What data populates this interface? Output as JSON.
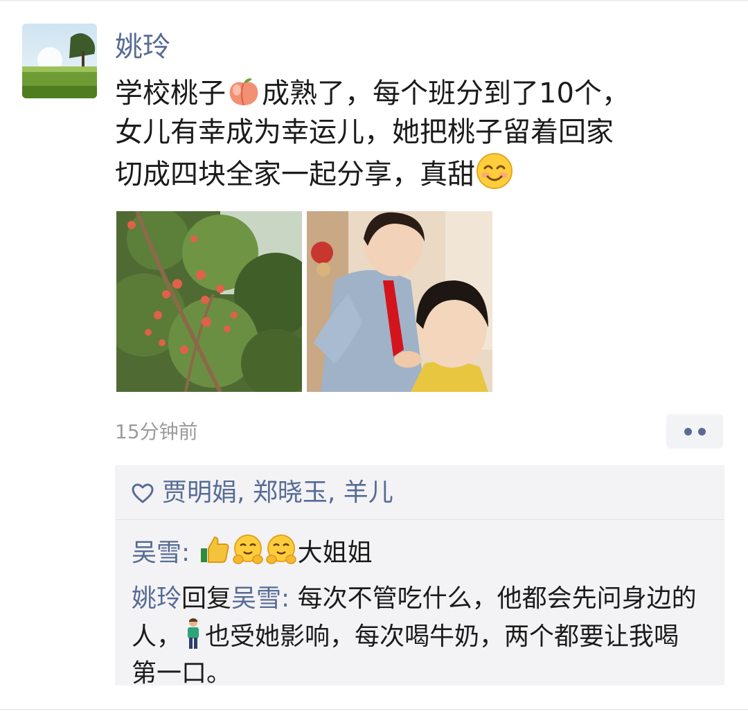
{
  "post": {
    "author": "姚玲",
    "text_part1": "学校桃子",
    "peach_emoji": "peach-emoji",
    "text_part2": "成熟了，每个班分到了10个，\n女儿有幸成为幸运儿，她把桃子留着回家\n切成四块全家一起分享，真甜",
    "smile_emoji": "smiling-face-emoji",
    "timestamp": "15分钟前"
  },
  "likes": {
    "names": "贾明娟, 郑晓玉, 羊儿"
  },
  "comments": [
    {
      "author": "吴雪",
      "separator": ": ",
      "emojis": [
        "thumbs-up-emoji",
        "hugging-face-emoji",
        "hugging-face-emoji"
      ],
      "text": "大姐姐"
    },
    {
      "author": "姚玲",
      "reply_word": "回复",
      "reply_to": "吴雪",
      "separator": ": ",
      "text_part1": "每次不管吃什么，他都会先问身边的人，",
      "emoji": "man-standing-emoji",
      "text_part2": "也受她影响，每次喝牛奶，两个都要让我喝第一口。"
    }
  ],
  "colors": {
    "link": "#576b95",
    "text": "#1b1b1b",
    "meta": "#9b9b9b",
    "panel": "#f3f3f5"
  }
}
